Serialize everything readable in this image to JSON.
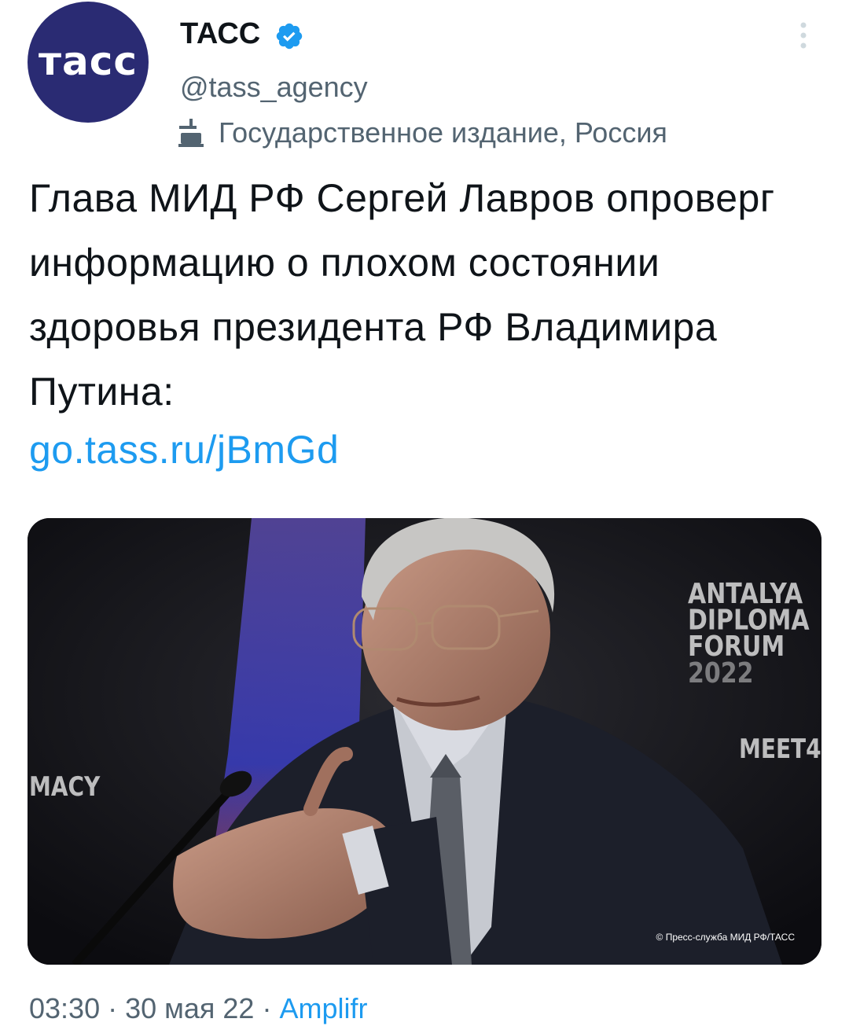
{
  "account": {
    "avatar_text": "тасс",
    "display_name": "ТАСС",
    "handle": "@tass_agency",
    "label": "Государственное издание, Россия",
    "verified_icon": "verified-badge-icon",
    "label_icon": "government-building-icon",
    "more_icon": "more-vertical-icon"
  },
  "tweet": {
    "text": "Глава МИД РФ Сергей Лавров опроверг информацию о плохом состоянии здоровья президента РФ Владимира Путина:",
    "link": "go.tass.ru/jBmGd",
    "media": {
      "photo_credit": "© Пресс-служба МИД РФ/ТАСС",
      "background_text": [
        "ANTALYA",
        "DIPLOMA",
        "FORUM",
        "2022",
        "MEET4",
        "MACY"
      ]
    },
    "time": "03:30",
    "date": "30 мая 22",
    "source": "Amplifr",
    "separator": "·"
  },
  "colors": {
    "accent": "#1d9bf0",
    "secondary_text": "#536471",
    "avatar_bg": "#2a2b73"
  }
}
